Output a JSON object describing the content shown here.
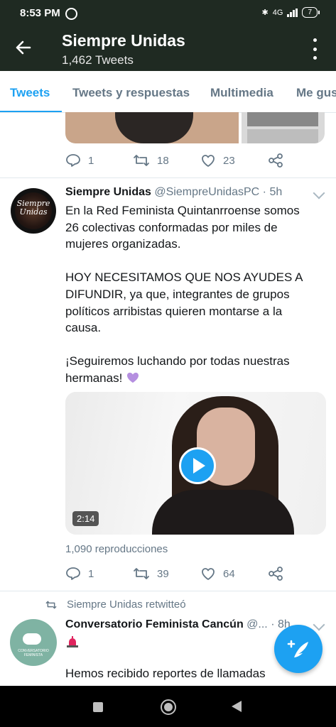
{
  "status_bar": {
    "time": "8:53 PM",
    "network": "4G",
    "battery": "7"
  },
  "header": {
    "title": "Siempre Unidas",
    "subtitle": "1,462 Tweets"
  },
  "tabs": [
    "Tweets",
    "Tweets y respuestas",
    "Multimedia",
    "Me gus"
  ],
  "prev_tweet": {
    "replies": "1",
    "retweets": "18",
    "likes": "23"
  },
  "tweet": {
    "name": "Siempre Unidas",
    "handle_time": " @SiempreUnidasPC · 5h",
    "avatar_text": "Siempre Unidas",
    "text": "En la Red Feminista Quintanrroense somos 26 colectivas conformadas por miles de mujeres organizadas.\n\nHOY NECESITAMOS QUE NOS AYUDES A DIFUNDIR, ya que, integrantes de grupos políticos arribistas quieren montarse a la causa.\n\n¡Seguiremos luchando por todas nuestras hermanas!",
    "video_duration": "2:14",
    "views": "1,090 reproducciones",
    "replies": "1",
    "retweets": "39",
    "likes": "64"
  },
  "retweet_tweet": {
    "retweeted_by": "Siempre Unidas retwitteó",
    "name": "Conversatorio Feminista Cancún",
    "handle_time": " @... · 8h",
    "avatar_text": "CONVERSATORIO FEMINISTA",
    "text": "Hemos recibido reportes de llamadas"
  },
  "colors": {
    "accent": "#1da1f2",
    "header_bg": "#1f2a22",
    "muted": "#657786"
  }
}
